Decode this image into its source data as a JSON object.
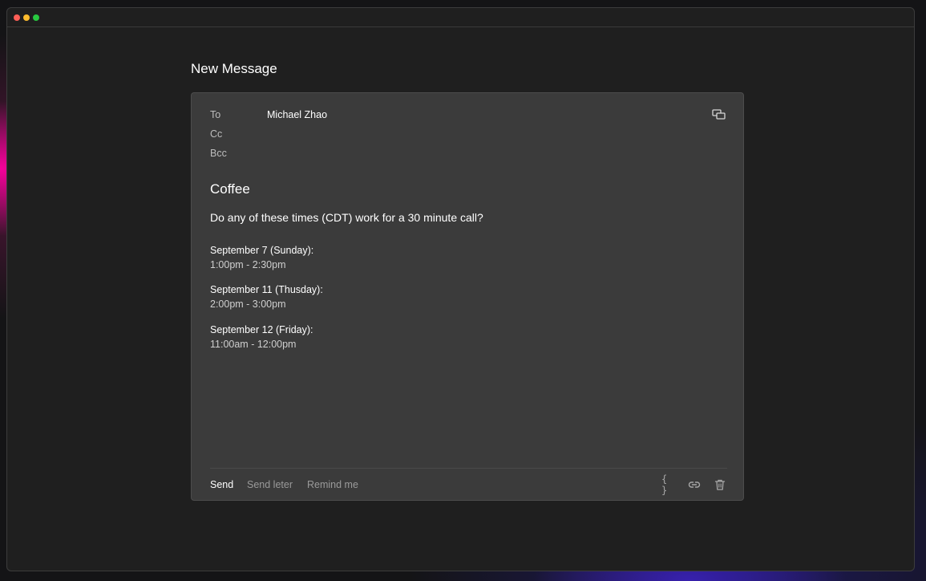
{
  "compose": {
    "title": "New Message",
    "to_label": "To",
    "to_value": "Michael Zhao",
    "cc_label": "Cc",
    "bcc_label": "Bcc",
    "subject": "Coffee",
    "body": {
      "question": "Do any of these times (CDT) work for a 30 minute call?",
      "slots": [
        {
          "date": "September 7 (Sunday):",
          "time": "1:00pm - 2:30pm"
        },
        {
          "date": "September 11 (Thusday):",
          "time": "2:00pm - 3:00pm"
        },
        {
          "date": "September 12 (Friday):",
          "time": "11:00am - 12:00pm"
        }
      ]
    }
  },
  "toolbar": {
    "send_label": "Send",
    "send_later_label": "Send leter",
    "remind_label": "Remind me",
    "braces_label": "{ }",
    "icons": [
      "popout-icon",
      "braces-icon",
      "link-icon",
      "trash-icon"
    ]
  },
  "colors": {
    "window_bg": "#1f1f1f",
    "card_bg": "#3b3b3b",
    "traffic_red": "#ff5f57",
    "traffic_yellow": "#febc2e",
    "traffic_green": "#28c840"
  }
}
